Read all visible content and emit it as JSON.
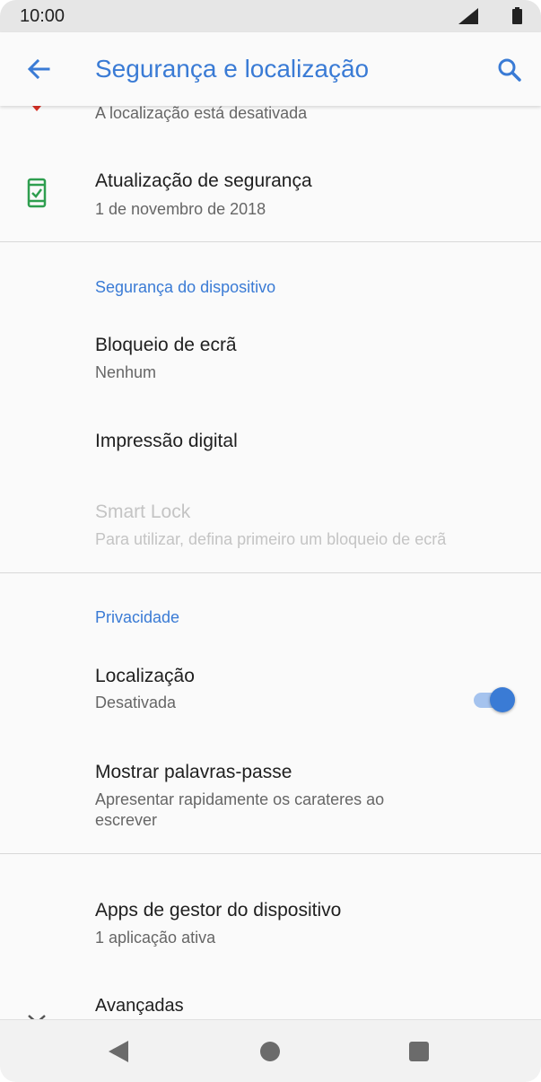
{
  "status_bar": {
    "time": "10:00"
  },
  "app_bar": {
    "title": "Segurança e localização"
  },
  "items": {
    "location_top_sub": "A localização está desativada",
    "security_update": {
      "title": "Atualização de segurança",
      "sub": "1 de novembro de 2018"
    },
    "device_security_header": "Segurança do dispositivo",
    "screen_lock": {
      "title": "Bloqueio de ecrã",
      "sub": "Nenhum"
    },
    "fingerprint": {
      "title": "Impressão digital"
    },
    "smart_lock": {
      "title": "Smart Lock",
      "sub": "Para utilizar, defina primeiro um bloqueio de ecrã"
    },
    "privacy_header": "Privacidade",
    "location": {
      "title": "Localização",
      "sub": "Desativada"
    },
    "show_passwords": {
      "title": "Mostrar palavras-passe",
      "sub_line1": "Apresentar rapidamente os carateres ao",
      "sub_line2": "escrever",
      "toggle_on": true
    },
    "device_admin": {
      "title": "Apps de gestor do dispositivo",
      "sub": "1 aplicação ativa"
    },
    "advanced": {
      "title": "Avançadas"
    }
  },
  "colors": {
    "accent": "#3a7bd5",
    "update_icon": "#2e9e4f",
    "warning_mark": "#d93025"
  },
  "icons": [
    "back-arrow",
    "search",
    "phone-check",
    "chevron-down",
    "nav-back",
    "nav-home",
    "nav-recents"
  ]
}
